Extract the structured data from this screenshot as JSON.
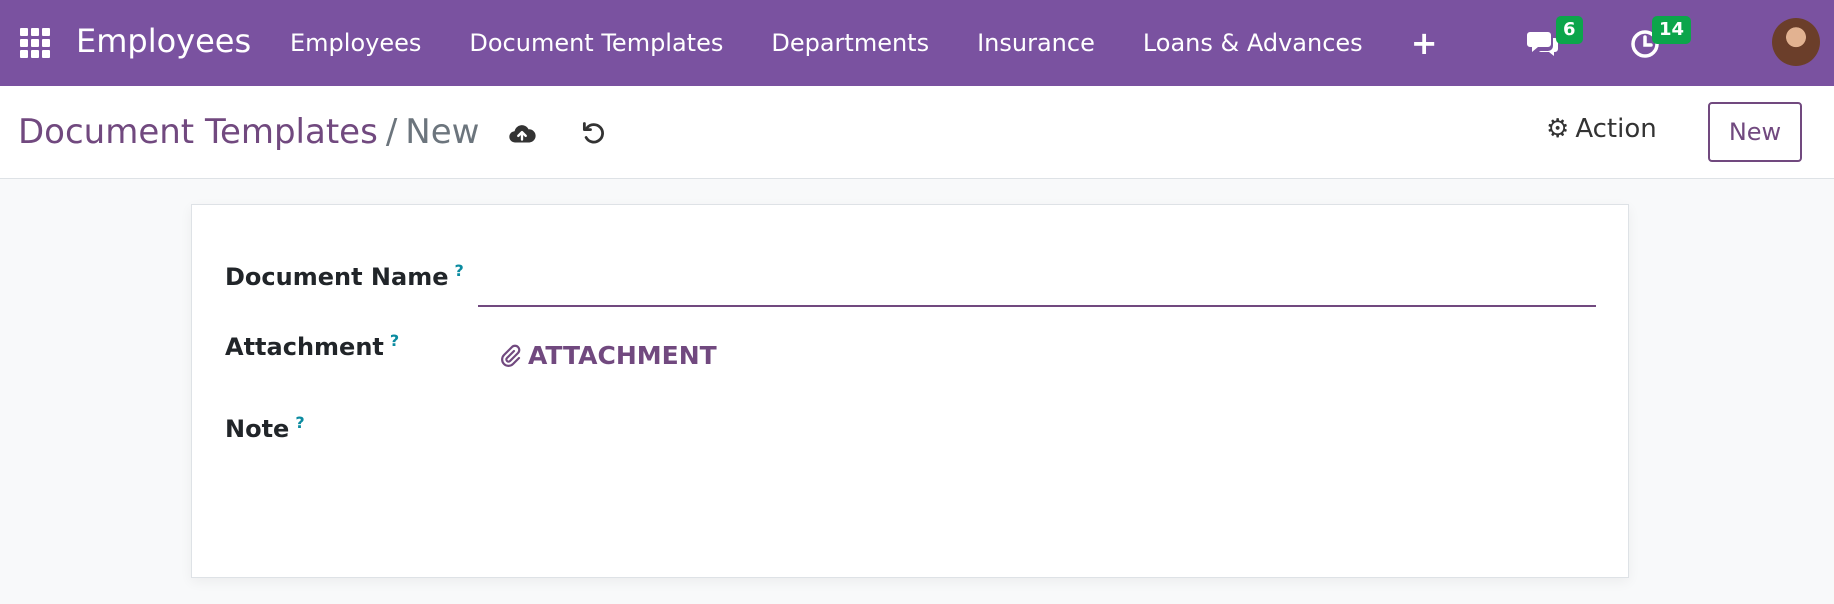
{
  "navbar": {
    "brand": "Employees",
    "menu": [
      {
        "label": "Employees"
      },
      {
        "label": "Document Templates"
      },
      {
        "label": "Departments"
      },
      {
        "label": "Insurance"
      },
      {
        "label": "Loans & Advances"
      }
    ],
    "plus_label": "+",
    "messages_count": "6",
    "activities_count": "14",
    "badge_color": "#0ca54b",
    "brand_color": "#7a52a0"
  },
  "control": {
    "breadcrumb_parent": "Document Templates",
    "breadcrumb_sep": "/",
    "breadcrumb_current": "New",
    "action_label": "Action",
    "new_label": "New"
  },
  "form": {
    "document_name_label": "Document Name",
    "document_name_value": "",
    "attachment_label": "Attachment",
    "attachment_button": "ATTACHMENT",
    "note_label": "Note",
    "help_mark": "?"
  }
}
